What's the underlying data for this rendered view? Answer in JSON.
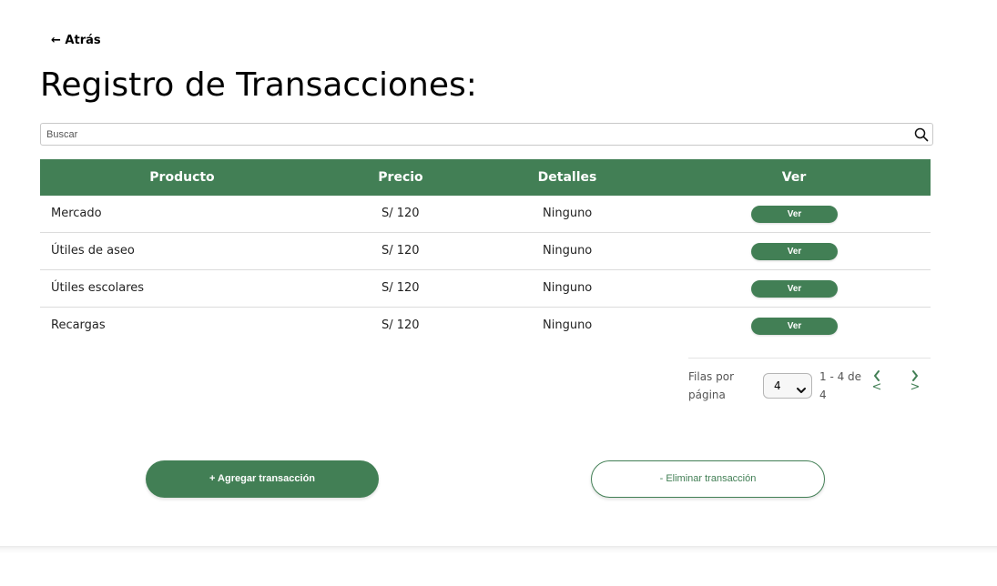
{
  "nav": {
    "back_label": "← Atrás"
  },
  "title": "Registro de Transacciones:",
  "search": {
    "placeholder": "Buscar",
    "value": "",
    "icon": "search-icon"
  },
  "table": {
    "headers": {
      "product": "Producto",
      "price": "Precio",
      "details": "Detalles",
      "view": "Ver"
    },
    "rows": [
      {
        "product": "Mercado",
        "price": "S/ 120",
        "details": "Ninguno",
        "action": "Ver"
      },
      {
        "product": "Útiles de aseo",
        "price": "S/ 120",
        "details": "Ninguno",
        "action": "Ver"
      },
      {
        "product": "Útiles escolares",
        "price": "S/ 120",
        "details": "Ninguno",
        "action": "Ver"
      },
      {
        "product": "Recargas",
        "price": "S/ 120",
        "details": "Ninguno",
        "action": "Ver"
      }
    ]
  },
  "pagination": {
    "rows_per_page_label": "Filas por página",
    "rows_per_page_value": "4",
    "range_text": "1 - 4 de 4",
    "prev_fallback": "<",
    "next_fallback": ">",
    "prev_icon": "chevron-left-icon",
    "next_icon": "chevron-right-icon"
  },
  "actions": {
    "add_label": "+ Agregar transacción",
    "delete_label": "- Eliminar transacción"
  },
  "colors": {
    "primary": "#427f55",
    "header_text": "#ffffff",
    "border": "#dcdcdc"
  }
}
